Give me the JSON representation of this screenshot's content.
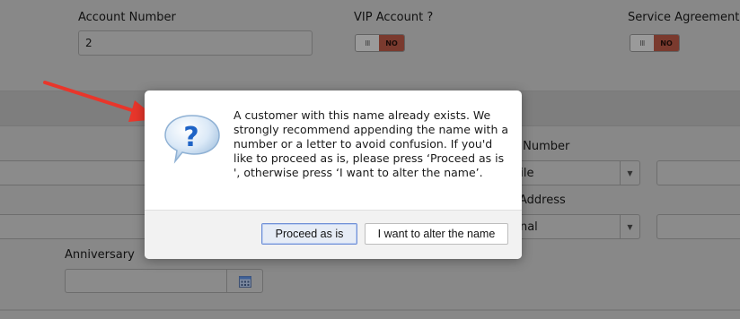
{
  "form": {
    "account_number_label": "Account Number",
    "account_number_value": "2",
    "vip_label": "VIP Account ?",
    "vip_toggle": {
      "off_glyph": "III",
      "state_label": "NO"
    },
    "service_label": "Service Agreement ?",
    "service_toggle": {
      "off_glyph": "III",
      "state_label": "NO"
    },
    "phone_label_fragment": "e Number",
    "phone_type_value": "bile",
    "address_label_fragment": "Address",
    "address_type_value": "onal",
    "anniversary_label": "Anniversary",
    "anniversary_value": ""
  },
  "dialog": {
    "icon": "question-bubble-icon",
    "message": "A customer with this name already exists. We strongly recommend appending the name with a number or a letter to avoid confusion. If you'd like to proceed as is, please press ‘Proceed as is ', otherwise press ‘I want to alter the name’.",
    "primary_button": "Proceed as is",
    "secondary_button": "I want to alter the name"
  },
  "annotation": {
    "icon": "red-arrow-icon",
    "color": "#e8362b"
  },
  "colors": {
    "toggle_no": "#7a3a2e",
    "primary_border": "#6f8fd6"
  }
}
